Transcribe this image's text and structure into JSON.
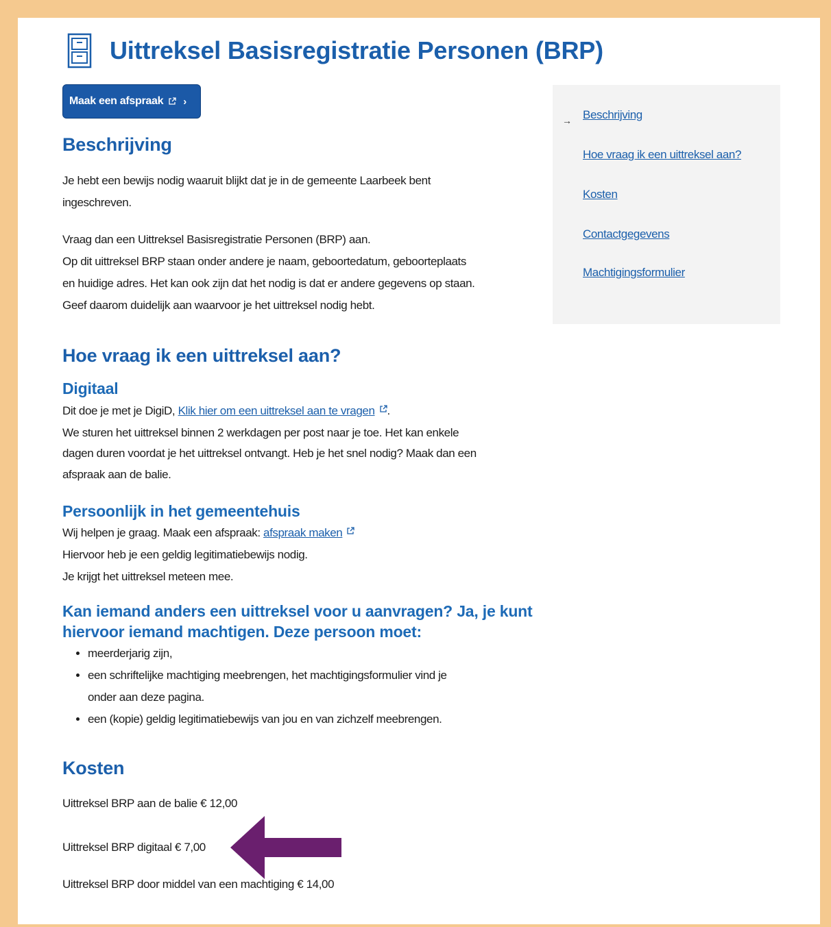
{
  "page": {
    "title": "Uittreksel Basisregistratie Personen (BRP)"
  },
  "cta": {
    "label": "Maak een afspraak"
  },
  "toc": {
    "items": [
      "Beschrijving",
      "Hoe vraag ik een uittreksel aan?",
      "Kosten",
      "Contactgegevens",
      "Machtigingsformulier"
    ]
  },
  "beschrijving": {
    "heading": "Beschrijving",
    "p1_line1": "Je hebt een bewijs nodig waaruit blijkt dat je in de gemeente Laarbeek bent",
    "p1_line2": "ingeschreven.",
    "p2_line1": "Vraag dan een Uittreksel Basisregistratie Personen (BRP) aan.",
    "p2_line2": "Op dit uittreksel BRP staan onder andere je naam, geboortedatum, geboorteplaats",
    "p2_line3": "en huidige adres. Het kan ook zijn dat het nodig is dat er andere gegevens op staan.",
    "p2_line4": "Geef daarom duidelijk aan waarvoor je het uittreksel nodig hebt."
  },
  "aanvragen": {
    "heading": "Hoe vraag ik een uittreksel aan?",
    "digitaal": {
      "heading": "Digitaal",
      "line1_prefix": "Dit doe je met je DigiD, ",
      "line1_link": "Klik hier om een uittreksel aan te vragen",
      "line1_suffix": ".",
      "line2": "We sturen het uittreksel binnen 2 werkdagen per post naar je toe. Het kan enkele",
      "line3": "dagen duren voordat je het uittreksel ontvangt. Heb je het snel nodig? Maak dan een",
      "line4": "afspraak aan de balie."
    },
    "persoonlijk": {
      "heading": "Persoonlijk in het gemeentehuis",
      "line1_prefix": "Wij helpen je graag. Maak een afspraak: ",
      "line1_link": "afspraak maken",
      "line2": "Hiervoor heb je een geldig legitimatiebewijs nodig.",
      "line3": "Je krijgt het uittreksel meteen mee."
    },
    "machtigen": {
      "heading_line1": "Kan iemand anders een uittreksel voor u aanvragen? Ja, je kunt",
      "heading_line2": "hiervoor iemand machtigen. Deze persoon moet:",
      "bullet1": "meerderjarig zijn,",
      "bullet2_line1": "een schriftelijke machtiging meebrengen, het machtigingsformulier vind je",
      "bullet2_line2": "onder aan deze pagina.",
      "bullet3": "een (kopie) geldig legitimatiebewijs van jou en van zichzelf meebrengen."
    }
  },
  "kosten": {
    "heading": "Kosten",
    "balie": "Uittreksel BRP aan de balie € 12,00",
    "digitaal": "Uittreksel BRP digitaal € 7,00",
    "machtiging": "Uittreksel BRP door middel van een machtiging € 14,00"
  },
  "colors": {
    "frame": "#f5c98f",
    "heading_blue": "#1b5fab",
    "button_blue": "#1b59a7",
    "annotation_arrow": "#6a1f6e"
  }
}
